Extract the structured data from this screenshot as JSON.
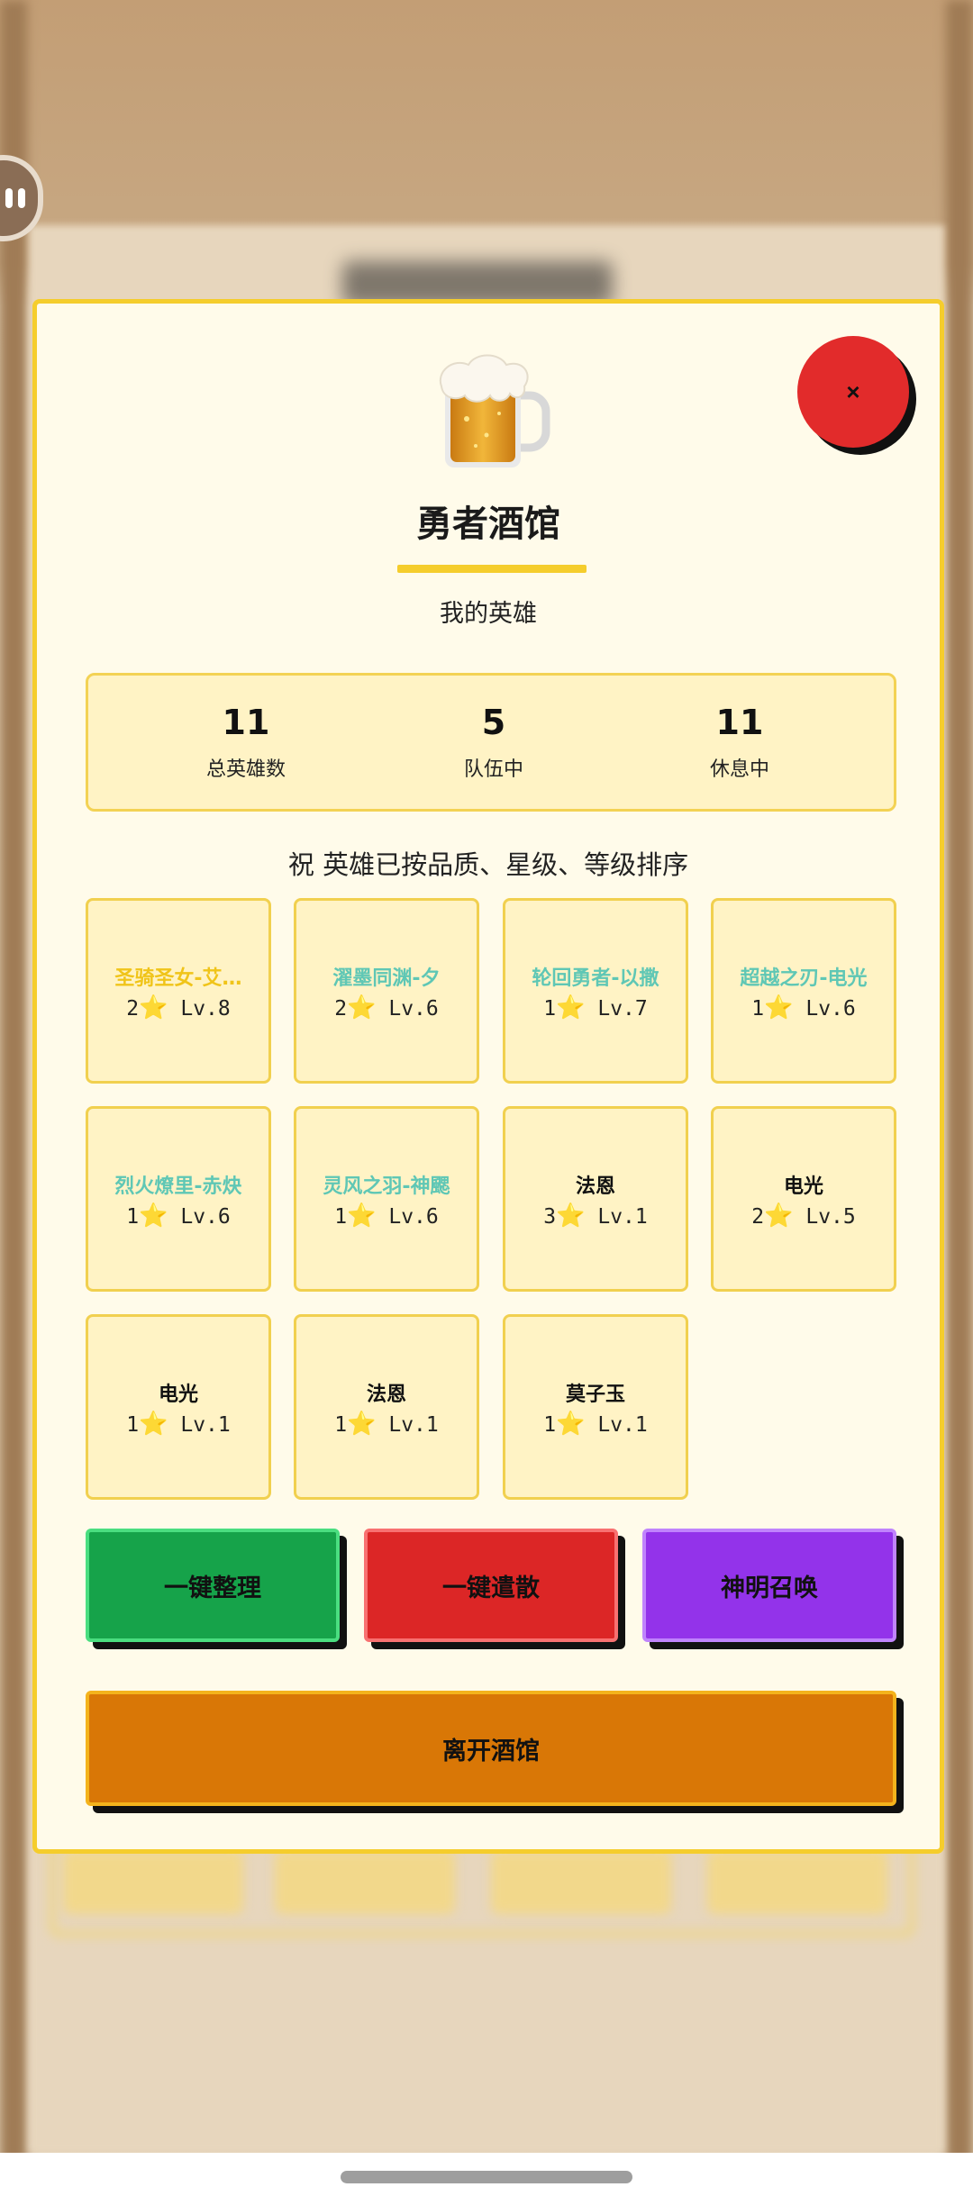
{
  "modal": {
    "close_label": "×",
    "title": "勇者酒馆",
    "subtitle": "我的英雄",
    "sort_note": "祝  英雄已按品质、星级、等级排序"
  },
  "stats": [
    {
      "value": "11",
      "label": "总英雄数"
    },
    {
      "value": "5",
      "label": "队伍中"
    },
    {
      "value": "11",
      "label": "休息中"
    }
  ],
  "heroes": [
    {
      "name": "圣骑圣女-艾…",
      "stars": "2",
      "level": "Lv.8",
      "name_color": "#f0c419"
    },
    {
      "name": "濯墨同渊-夕",
      "stars": "2",
      "level": "Lv.6",
      "name_color": "#5fc7b5"
    },
    {
      "name": "轮回勇者-以撒",
      "stars": "1",
      "level": "Lv.7",
      "name_color": "#5fc7b5"
    },
    {
      "name": "超越之刃-电光",
      "stars": "1",
      "level": "Lv.6",
      "name_color": "#5fc7b5"
    },
    {
      "name": "烈火燎里-赤炔",
      "stars": "1",
      "level": "Lv.6",
      "name_color": "#5fc7b5"
    },
    {
      "name": "灵风之羽-神颸",
      "stars": "1",
      "level": "Lv.6",
      "name_color": "#5fc7b5"
    },
    {
      "name": "法恩",
      "stars": "3",
      "level": "Lv.1",
      "name_color": "#111111"
    },
    {
      "name": "电光",
      "stars": "2",
      "level": "Lv.5",
      "name_color": "#111111"
    },
    {
      "name": "电光",
      "stars": "1",
      "level": "Lv.1",
      "name_color": "#111111"
    },
    {
      "name": "法恩",
      "stars": "1",
      "level": "Lv.1",
      "name_color": "#111111"
    },
    {
      "name": "莫子玉",
      "stars": "1",
      "level": "Lv.1",
      "name_color": "#111111"
    }
  ],
  "actions": [
    {
      "label": "一键整理",
      "color": "#16a34a",
      "border": "#4ade80"
    },
    {
      "label": "一键遣散",
      "color": "#dc2626",
      "border": "#f87171"
    },
    {
      "label": "神明召唤",
      "color": "#9333ea",
      "border": "#c084fc"
    }
  ],
  "leave_label": "离开酒馆",
  "icons": {
    "star": "⭐",
    "close": "×",
    "beer": "beer-mug-icon",
    "pause": "pause-icon"
  }
}
